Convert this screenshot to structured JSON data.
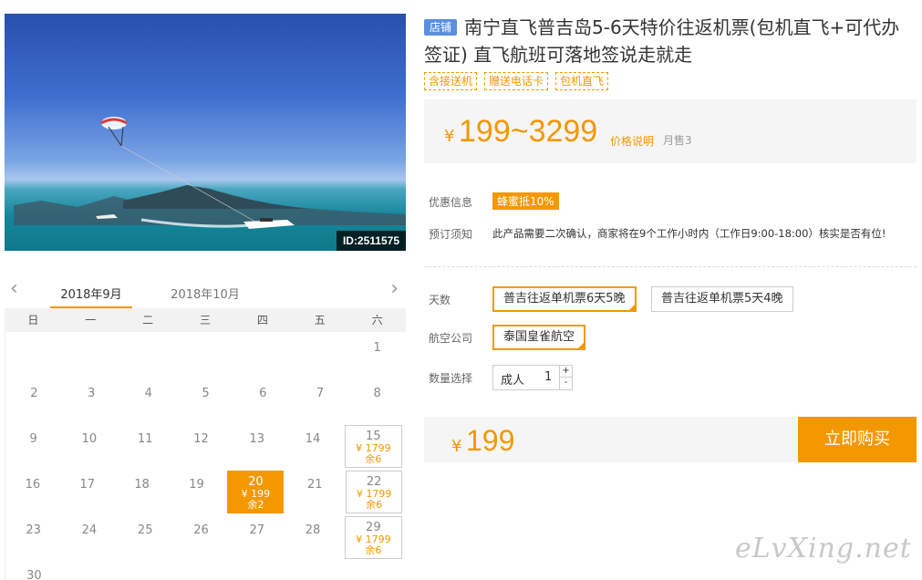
{
  "photo": {
    "id_label": "ID:2511575"
  },
  "product": {
    "shop_badge": "店铺",
    "title": "南宁直飞普吉岛5-6天特价往返机票(包机直飞+可代办签证) 直飞航班可落地签说走就走",
    "tags": [
      "含接送机",
      "赠送电话卡",
      "包机直飞"
    ],
    "price_currency": "¥",
    "price_range": "199~3299",
    "price_explain": "价格说明",
    "monthly_sales": "月售3"
  },
  "info": {
    "promo_label": "优惠信息",
    "promo_value": "蜂蜜抵10%",
    "notice_label": "预订须知",
    "notice_value": "此产品需要二次确认，商家将在9个工作小时内（工作日9:00-18:00）核实是否有位!"
  },
  "options": {
    "days_label": "天数",
    "days": [
      "普吉往返单机票6天5晚",
      "普吉往返单机票5天4晚"
    ],
    "airline_label": "航空公司",
    "airline": "泰国皇雀航空",
    "qty_label": "数量选择",
    "qty_type": "成人",
    "qty_value": "1",
    "plus": "+",
    "minus": "-"
  },
  "buy": {
    "currency": "¥",
    "price": "199",
    "button": "立即购买"
  },
  "calendar": {
    "prev": "‹",
    "next": "›",
    "months": [
      "2018年9月",
      "2018年10月"
    ],
    "weekdays": [
      "日",
      "一",
      "二",
      "三",
      "四",
      "五",
      "六"
    ],
    "rows": [
      [
        {
          "d": ""
        },
        {
          "d": ""
        },
        {
          "d": ""
        },
        {
          "d": ""
        },
        {
          "d": ""
        },
        {
          "d": ""
        },
        {
          "d": "1"
        }
      ],
      [
        {
          "d": "2"
        },
        {
          "d": "3"
        },
        {
          "d": "4"
        },
        {
          "d": "5"
        },
        {
          "d": "6"
        },
        {
          "d": "7"
        },
        {
          "d": "8"
        }
      ],
      [
        {
          "d": "9"
        },
        {
          "d": "10"
        },
        {
          "d": "11"
        },
        {
          "d": "12"
        },
        {
          "d": "13"
        },
        {
          "d": "14"
        },
        {
          "d": "15",
          "p": "¥ 1799",
          "s": "余6"
        }
      ],
      [
        {
          "d": "16"
        },
        {
          "d": "17"
        },
        {
          "d": "18"
        },
        {
          "d": "19"
        },
        {
          "d": "20",
          "p": "¥ 199",
          "s": "余2",
          "sel": true
        },
        {
          "d": "21"
        },
        {
          "d": "22",
          "p": "¥ 1799",
          "s": "余6"
        }
      ],
      [
        {
          "d": "23"
        },
        {
          "d": "24"
        },
        {
          "d": "25"
        },
        {
          "d": "26"
        },
        {
          "d": "27"
        },
        {
          "d": "28"
        },
        {
          "d": "29",
          "p": "¥ 1799",
          "s": "余6"
        }
      ],
      [
        {
          "d": "30"
        },
        {
          "d": ""
        },
        {
          "d": ""
        },
        {
          "d": ""
        },
        {
          "d": ""
        },
        {
          "d": ""
        },
        {
          "d": ""
        }
      ]
    ]
  },
  "watermark": "eLvXing.net"
}
